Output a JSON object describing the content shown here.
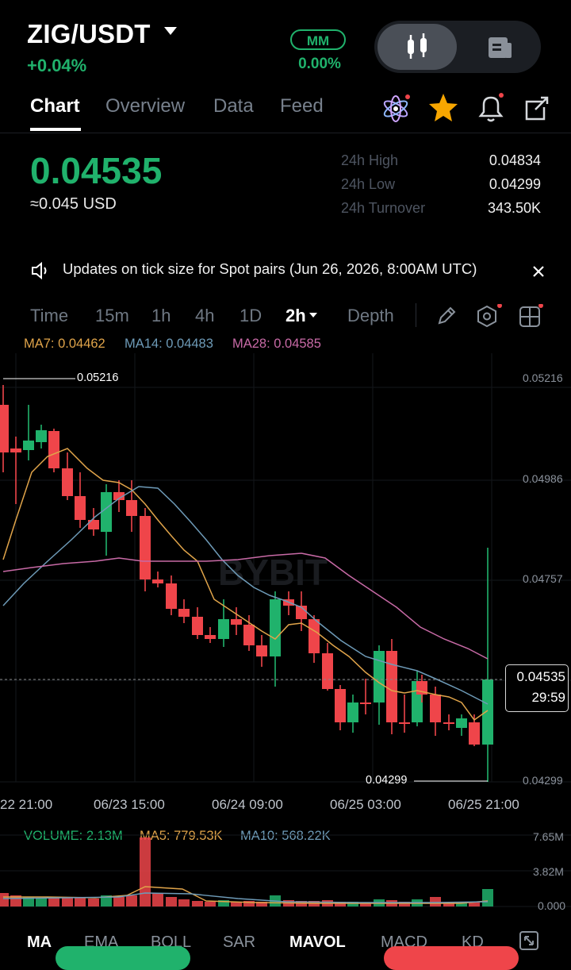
{
  "header": {
    "pair": "ZIG/USDT",
    "change": "+0.04%",
    "mm_label": "MM",
    "mm_value": "0.00%"
  },
  "tabs": [
    "Chart",
    "Overview",
    "Data",
    "Feed"
  ],
  "price": {
    "last": "0.04535",
    "usd": "≈0.045 USD",
    "high_label": "24h High",
    "high": "0.04834",
    "low_label": "24h Low",
    "low": "0.04299",
    "turnover_label": "24h Turnover",
    "turnover": "343.50K"
  },
  "notice": "Updates on tick size for Spot pairs (Jun 26, 2026, 8:00AM UTC)",
  "intervals": [
    "Time",
    "15m",
    "1h",
    "4h",
    "1D",
    "2h",
    "Depth"
  ],
  "ma_legend": {
    "ma7": "MA7: 0.04462",
    "ma14": "MA14: 0.04483",
    "ma28": "MA28: 0.04585"
  },
  "chart_data": {
    "type": "candlestick",
    "y_ticks": [
      "0.05216",
      "0.04986",
      "0.04757",
      "0.04299"
    ],
    "x_ticks": [
      "22 21:00",
      "06/23 15:00",
      "06/24 09:00",
      "06/25 03:00",
      "06/25 21:00"
    ],
    "high_marker": "0.05216",
    "low_marker": "0.04299",
    "current_price": "0.04535",
    "countdown": "29:59",
    "watermark": "BYBIT",
    "colors": {
      "up": "#20b26c",
      "down": "#ef454a",
      "ma7": "#e0a44a",
      "ma14": "#6e9bb8",
      "ma28": "#c86aa6"
    }
  },
  "volume": {
    "legend_vol": "VOLUME: 2.13M",
    "legend_ma5": "MA5: 779.53K",
    "legend_ma10": "MA10: 568.22K",
    "axis": [
      "7.65M",
      "3.82M",
      "0.000"
    ]
  },
  "indicator_tabs": [
    "MA",
    "EMA",
    "BOLL",
    "SAR",
    "MAVOL",
    "MACD",
    "KD"
  ]
}
